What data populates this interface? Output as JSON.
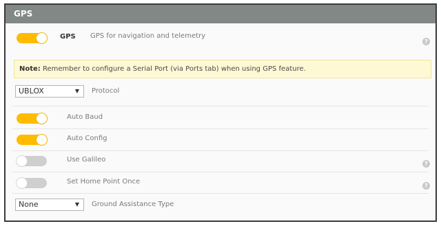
{
  "panel": {
    "title": "GPS"
  },
  "gps": {
    "label": "GPS",
    "description": "GPS for navigation and telemetry",
    "enabled": true
  },
  "note": {
    "prefix": "Note:",
    "text": "Remember to configure a Serial Port (via Ports tab) when using GPS feature."
  },
  "protocol": {
    "selected": "UBLOX",
    "label": "Protocol"
  },
  "auto_baud": {
    "label": "Auto Baud",
    "enabled": true
  },
  "auto_config": {
    "label": "Auto Config",
    "enabled": true
  },
  "use_galileo": {
    "label": "Use Galileo",
    "enabled": false
  },
  "set_home_point_once": {
    "label": "Set Home Point Once",
    "enabled": false
  },
  "ground_assistance": {
    "selected": "None",
    "label": "Ground Assistance Type"
  },
  "help_icon": {
    "glyph": "?"
  },
  "colors": {
    "toggle_on": "#ffbb00",
    "toggle_off": "#cfcfcf",
    "header": "#828885",
    "note_bg": "#fef8d5"
  }
}
